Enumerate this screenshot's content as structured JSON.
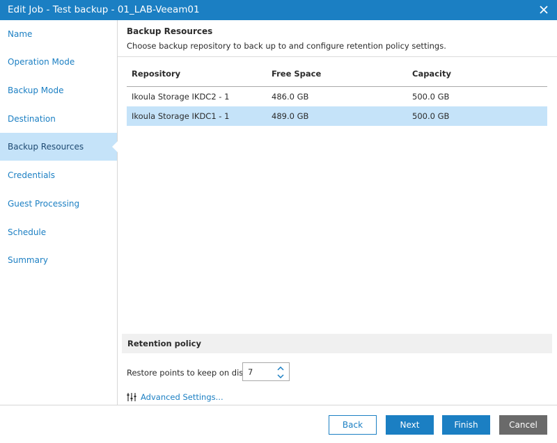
{
  "window": {
    "title": "Edit Job - Test backup - 01_LAB-Veeam01"
  },
  "sidebar": {
    "items": [
      {
        "label": "Name"
      },
      {
        "label": "Operation Mode"
      },
      {
        "label": "Backup Mode"
      },
      {
        "label": "Destination"
      },
      {
        "label": "Backup Resources"
      },
      {
        "label": "Credentials"
      },
      {
        "label": "Guest Processing"
      },
      {
        "label": "Schedule"
      },
      {
        "label": "Summary"
      }
    ],
    "active": "Backup Resources"
  },
  "header": {
    "title": "Backup Resources",
    "description": "Choose backup repository to back up to and configure retention policy settings."
  },
  "table": {
    "columns": [
      "Repository",
      "Free Space",
      "Capacity"
    ],
    "rows": [
      {
        "repository": "Ikoula Storage IKDC2 - 1",
        "free_space": "486.0 GB",
        "capacity": "500.0 GB"
      },
      {
        "repository": "Ikoula Storage IKDC1 - 1",
        "free_space": "489.0 GB",
        "capacity": "500.0 GB"
      }
    ],
    "selected_row": 1
  },
  "retention": {
    "title": "Retention policy",
    "restore_label": "Restore points to keep on disk:",
    "restore_points": "7",
    "advanced_label": "Advanced Settings..."
  },
  "buttons": {
    "back": "Back",
    "next": "Next",
    "finish": "Finish",
    "cancel": "Cancel"
  },
  "colors": {
    "accent": "#1b7fc3",
    "selection": "#c5e3f9",
    "cancel": "#6a6a6a"
  },
  "icons": {
    "close": "close-icon",
    "spin_up": "chevron-up-icon",
    "spin_down": "chevron-down-icon",
    "advanced": "sliders-icon"
  }
}
